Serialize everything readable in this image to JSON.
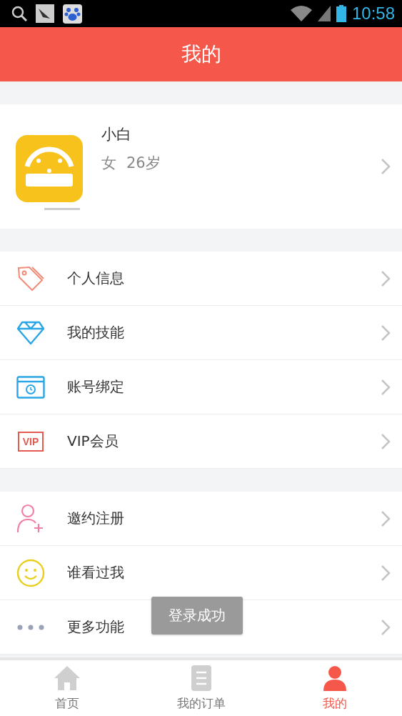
{
  "status_bar": {
    "time": "10:58"
  },
  "header": {
    "title": "我的"
  },
  "profile": {
    "name": "小白",
    "gender": "女",
    "age": "26岁"
  },
  "menu_groups": [
    {
      "items": [
        {
          "kind": "tag",
          "label": "个人信息"
        },
        {
          "kind": "diamond",
          "label": "我的技能"
        },
        {
          "kind": "card",
          "label": "账号绑定"
        },
        {
          "kind": "vip",
          "icon_text": "VIP",
          "label": "VIP会员"
        }
      ]
    },
    {
      "items": [
        {
          "kind": "add-user",
          "label": "邀约注册"
        },
        {
          "kind": "smile",
          "label": "谁看过我"
        },
        {
          "kind": "dots",
          "label": "更多功能"
        }
      ]
    }
  ],
  "toast": "登录成功",
  "tabs": [
    {
      "kind": "home",
      "label": "首页",
      "selected": false
    },
    {
      "kind": "orders",
      "label": "我的订单",
      "selected": false
    },
    {
      "kind": "me",
      "label": "我的",
      "selected": true
    }
  ]
}
